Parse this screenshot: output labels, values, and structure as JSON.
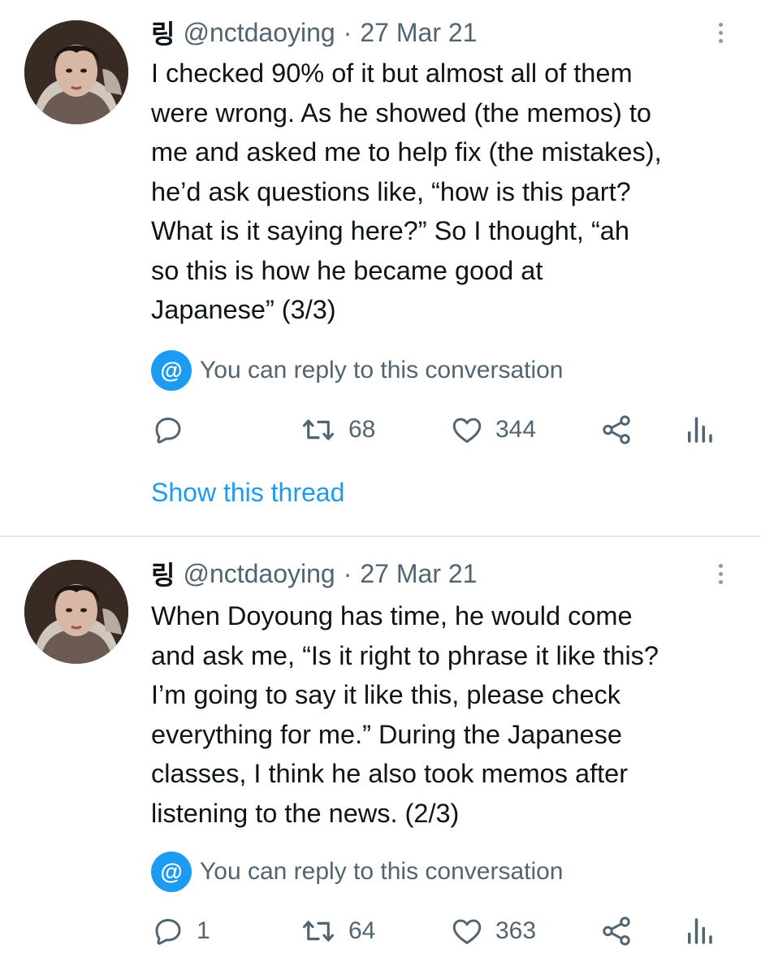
{
  "tweets": [
    {
      "display_name": "링",
      "handle": "@nctdaoying",
      "separator": "·",
      "date": "27 Mar 21",
      "text": "I checked 90% of it but almost all of them\nwere wrong. As he showed (the memos) to\nme and asked me to help fix (the mistakes),\nhe’d ask questions like, “how is this part?\nWhat is it saying here?” So I thought, “ah\nso this is how he became good at\nJapanese” (3/3)",
      "reply_notice": "You can reply to this conversation",
      "reply_icon": "@",
      "reply_count": "",
      "retweet_count": "68",
      "like_count": "344",
      "show_thread": "Show this thread"
    },
    {
      "display_name": "링",
      "handle": "@nctdaoying",
      "separator": "·",
      "date": "27 Mar 21",
      "text": "When Doyoung has time, he would come\nand ask me, “Is it right to phrase it like this?\nI’m going to say it like this, please check\neverything for me.” During the Japanese\nclasses, I think he also took memos after\nlistening to the news. (2/3)",
      "reply_notice": "You can reply to this conversation",
      "reply_icon": "@",
      "reply_count": "1",
      "retweet_count": "64",
      "like_count": "363"
    }
  ],
  "colors": {
    "accent": "#1d9bf0",
    "text": "#0f1419",
    "secondary": "#536471",
    "divider": "#e4e8eb"
  },
  "icons": [
    "reply-icon",
    "retweet-icon",
    "like-icon",
    "share-icon",
    "analytics-icon",
    "more-icon",
    "at-mention-icon"
  ]
}
